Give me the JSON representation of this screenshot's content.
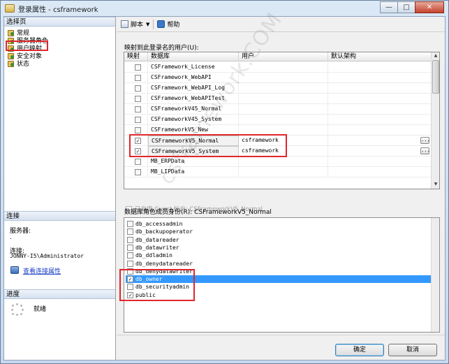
{
  "window": {
    "title": "登录属性 - csframework",
    "minimize_glyph": "—",
    "maximize_glyph": "□",
    "close_glyph": "✕"
  },
  "left_pane": {
    "select_page_header": "选择页",
    "nav_items": [
      {
        "label": "常规",
        "icon": "page-wrench-icon"
      },
      {
        "label": "服务器角色",
        "icon": "page-wrench-icon"
      },
      {
        "label": "用户映射",
        "icon": "page-wrench-icon",
        "selected": true
      },
      {
        "label": "安全对象",
        "icon": "page-wrench-icon"
      },
      {
        "label": "状态",
        "icon": "page-wrench-icon"
      }
    ],
    "connection_header": "连接",
    "server_label": "服务器:",
    "server_value": ".",
    "connection_label": "连接:",
    "connection_value": "JONNY-I5\\Administrator",
    "view_connection_link": "查看连接属性",
    "progress_header": "进度",
    "progress_status": "就绪"
  },
  "toolbar": {
    "script_label": "脚本",
    "script_dropdown_glyph": "▼",
    "help_label": "帮助"
  },
  "mapping": {
    "section_label": "映射到此登录名的用户(U):",
    "columns": [
      "映射",
      "数据库",
      "用户",
      "默认架构"
    ],
    "ellipsis_label": "...",
    "rows": [
      {
        "mapped": false,
        "database": "CSFramework_License",
        "user": ""
      },
      {
        "mapped": false,
        "database": "CSFramework_WebAPI",
        "user": ""
      },
      {
        "mapped": false,
        "database": "CSFramework_WebAPI_Log",
        "user": ""
      },
      {
        "mapped": false,
        "database": "CSFramework_WebAPITest",
        "user": ""
      },
      {
        "mapped": false,
        "database": "CSFrameworkV45_Normal",
        "user": ""
      },
      {
        "mapped": false,
        "database": "CSFrameworkV45_System",
        "user": ""
      },
      {
        "mapped": false,
        "database": "CSFrameworkV5_New",
        "user": ""
      },
      {
        "mapped": true,
        "database": "CSFrameworkV5_Normal",
        "user": "csframework"
      },
      {
        "mapped": true,
        "database": "CSFrameworkV5_System",
        "user": "csframework"
      },
      {
        "mapped": false,
        "database": "MB_ERPData",
        "user": ""
      },
      {
        "mapped": false,
        "database": "MB_LIPData",
        "user": ""
      }
    ],
    "check_glyph": "✓",
    "scroll_up_glyph": "▲",
    "scroll_down_glyph": "▼"
  },
  "guest": {
    "label": "已启用 Guest 帐户: CSFrameworkV5_Normal"
  },
  "roles": {
    "section_label": "数据库角色成员身份(R): CSFrameworkV5_Normal",
    "items": [
      {
        "name": "db_accessadmin",
        "checked": false
      },
      {
        "name": "db_backupoperator",
        "checked": false
      },
      {
        "name": "db_datareader",
        "checked": false
      },
      {
        "name": "db_datawriter",
        "checked": false
      },
      {
        "name": "db_ddladmin",
        "checked": false
      },
      {
        "name": "db_denydatareader",
        "checked": false
      },
      {
        "name": "db_denydatawriter",
        "checked": false
      },
      {
        "name": "db_owner",
        "checked": true,
        "selected": true
      },
      {
        "name": "db_securityadmin",
        "checked": false
      },
      {
        "name": "public",
        "checked": true
      }
    ]
  },
  "buttons": {
    "ok": "确定",
    "cancel": "取消"
  },
  "watermark": "csframework.COM",
  "colors": {
    "highlight_red": "#e0262b",
    "selection_blue": "#3399ff",
    "link_blue": "#1a3fc7"
  }
}
